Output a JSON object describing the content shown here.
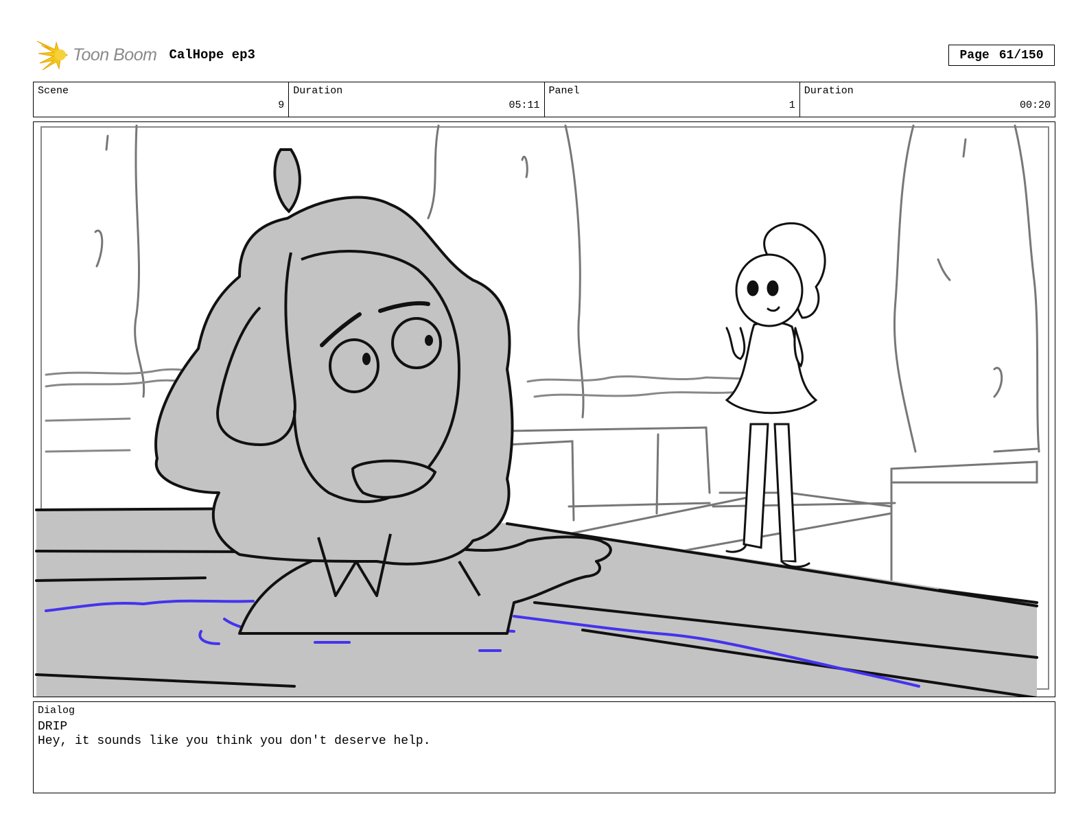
{
  "header": {
    "logo_text": "Toon Boom",
    "project_title": "CalHope ep3",
    "page_label": "Page",
    "page_value": "61/150"
  },
  "info": [
    {
      "label": "Scene",
      "value": "9"
    },
    {
      "label": "Duration",
      "value": "05:11"
    },
    {
      "label": "Panel",
      "value": "1"
    },
    {
      "label": "Duration",
      "value": "00:20"
    }
  ],
  "dialog": {
    "label": "Dialog",
    "speaker": "DRIP",
    "line": "Hey, it sounds like you think you don't deserve help."
  },
  "colors": {
    "water_line": "#4433ee",
    "character_fill": "#c3c3c3",
    "logo_accent": "#f4c81c"
  }
}
